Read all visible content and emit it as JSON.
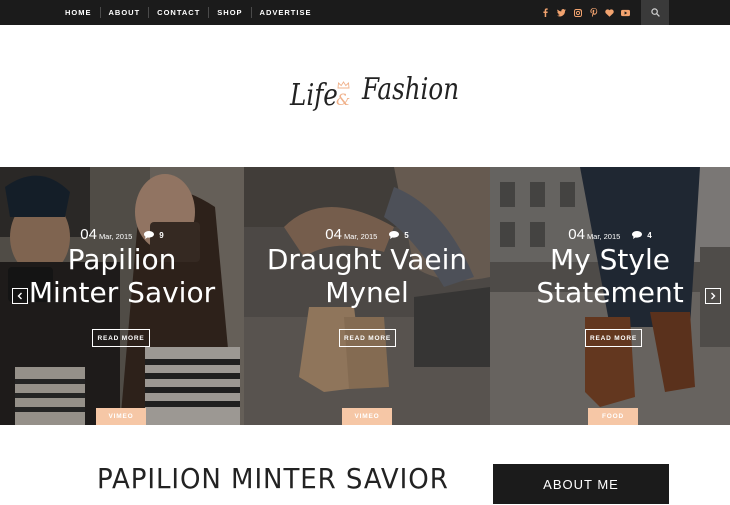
{
  "nav": {
    "items": [
      "HOME",
      "ABOUT",
      "CONTACT",
      "SHOP",
      "ADVERTISE"
    ]
  },
  "social": {
    "icons": [
      "facebook-icon",
      "twitter-icon",
      "instagram-icon",
      "pinterest-icon",
      "heart-icon",
      "youtube-icon"
    ]
  },
  "search": {
    "icon": "search-icon"
  },
  "logo": {
    "word1": "Life",
    "amp": "&",
    "word2": "Fashion",
    "accent_color": "#f0b18a"
  },
  "slider": {
    "slides": [
      {
        "day": "04",
        "month": "Mar, 2015",
        "comments": "9",
        "title_line1": "Papilion",
        "title_line2": "Minter Savior",
        "button": "READ MORE",
        "tag": "VIMEO"
      },
      {
        "day": "04",
        "month": "Mar, 2015",
        "comments": "5",
        "title_line1": "Draught Vaein",
        "title_line2": "Mynel",
        "button": "READ MORE",
        "tag": "VIMEO"
      },
      {
        "day": "04",
        "month": "Mar, 2015",
        "comments": "4",
        "title_line1": "My Style",
        "title_line2": "Statement",
        "button": "READ MORE",
        "tag": "FOOD"
      }
    ],
    "prev_icon": "chevron-left-icon",
    "next_icon": "chevron-right-icon",
    "tag_color": "#f6c7a6"
  },
  "main": {
    "post_title": "PAPILION MINTER SAVIOR"
  },
  "sidebar": {
    "about_title": "ABOUT ME"
  }
}
